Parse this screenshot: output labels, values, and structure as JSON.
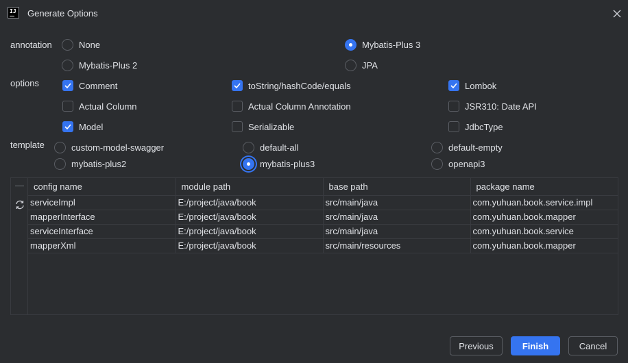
{
  "window": {
    "title": "Generate Options",
    "icon": "intellij-icon",
    "icon_text": "IJ"
  },
  "annotation": {
    "label": "annotation",
    "options": [
      {
        "label": "None",
        "selected": false
      },
      {
        "label": "Mybatis-Plus 3",
        "selected": true
      },
      {
        "label": "Mybatis-Plus 2",
        "selected": false
      },
      {
        "label": "JPA",
        "selected": false
      }
    ]
  },
  "options": {
    "label": "options",
    "items": [
      {
        "label": "Comment",
        "checked": true
      },
      {
        "label": "toString/hashCode/equals",
        "checked": true
      },
      {
        "label": "Lombok",
        "checked": true
      },
      {
        "label": "Actual Column",
        "checked": false
      },
      {
        "label": "Actual Column Annotation",
        "checked": false
      },
      {
        "label": "JSR310: Date API",
        "checked": false
      },
      {
        "label": "Model",
        "checked": true
      },
      {
        "label": "Serializable",
        "checked": false
      },
      {
        "label": "JdbcType",
        "checked": false
      }
    ]
  },
  "template": {
    "label": "template",
    "options": [
      {
        "label": "custom-model-swagger",
        "selected": false
      },
      {
        "label": "default-all",
        "selected": false
      },
      {
        "label": "default-empty",
        "selected": false
      },
      {
        "label": "mybatis-plus2",
        "selected": false
      },
      {
        "label": "mybatis-plus3",
        "selected": true
      },
      {
        "label": "openapi3",
        "selected": false
      }
    ]
  },
  "table": {
    "columns": [
      "config name",
      "module path",
      "base path",
      "package name"
    ],
    "rows": [
      [
        "serviceImpl",
        "E:/project/java/book",
        "src/main/java",
        "com.yuhuan.book.service.impl"
      ],
      [
        "mapperInterface",
        "E:/project/java/book",
        "src/main/java",
        "com.yuhuan.book.mapper"
      ],
      [
        "serviceInterface",
        "E:/project/java/book",
        "src/main/java",
        "com.yuhuan.book.service"
      ],
      [
        "mapperXml",
        "E:/project/java/book",
        "src/main/resources",
        "com.yuhuan.book.mapper"
      ]
    ]
  },
  "buttons": {
    "previous": "Previous",
    "finish": "Finish",
    "cancel": "Cancel"
  },
  "colors": {
    "background": "#2b2d30",
    "accent": "#3574f0",
    "text": "#dfe1e5",
    "border": "#393b40"
  }
}
